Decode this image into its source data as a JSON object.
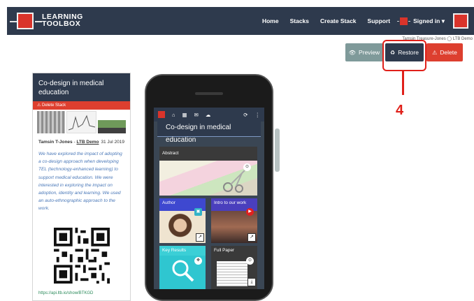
{
  "navbar": {
    "logo_line1": "LEARNING",
    "logo_line2": "TOOLBOX",
    "links": [
      "Home",
      "Stacks",
      "Create Stack",
      "Support"
    ],
    "signed_in": "Signed in ▾"
  },
  "userline": "Tamsin Treasure-Jones  ◯ LTB Demo",
  "actions": {
    "preview_label": "Preview",
    "restore_label": "Restore",
    "delete_label": "Delete"
  },
  "callout": {
    "step": "4",
    "color": "#e0201a"
  },
  "card": {
    "title": "Co-design in medical education",
    "delete_label": "Delete Stack",
    "author": "Tamsin T-Jones",
    "group": "LTB Demo",
    "date": "31 Jul 2019",
    "description": "We have explored the impact of adopting a co-design approach when developing TEL (technology-enhanced learning) to support medical education. We were interested in exploring the impact on adoption, identity and learning. We used an auto-ethnographic approach to the work.",
    "link": "https://api.ltb.io/show/BTKGD"
  },
  "phone": {
    "app_title": "Co-design in medical education",
    "tiles": [
      {
        "label": "Abstract"
      },
      {
        "label": "Author"
      },
      {
        "label": "Intro to our work"
      },
      {
        "label": "Key Results"
      },
      {
        "label": "Full Paper"
      }
    ]
  },
  "colors": {
    "navbar": "#2e3a4d",
    "brand_red": "#d9342b",
    "preview": "#7f9a9a",
    "delete": "#dd3f2f"
  }
}
